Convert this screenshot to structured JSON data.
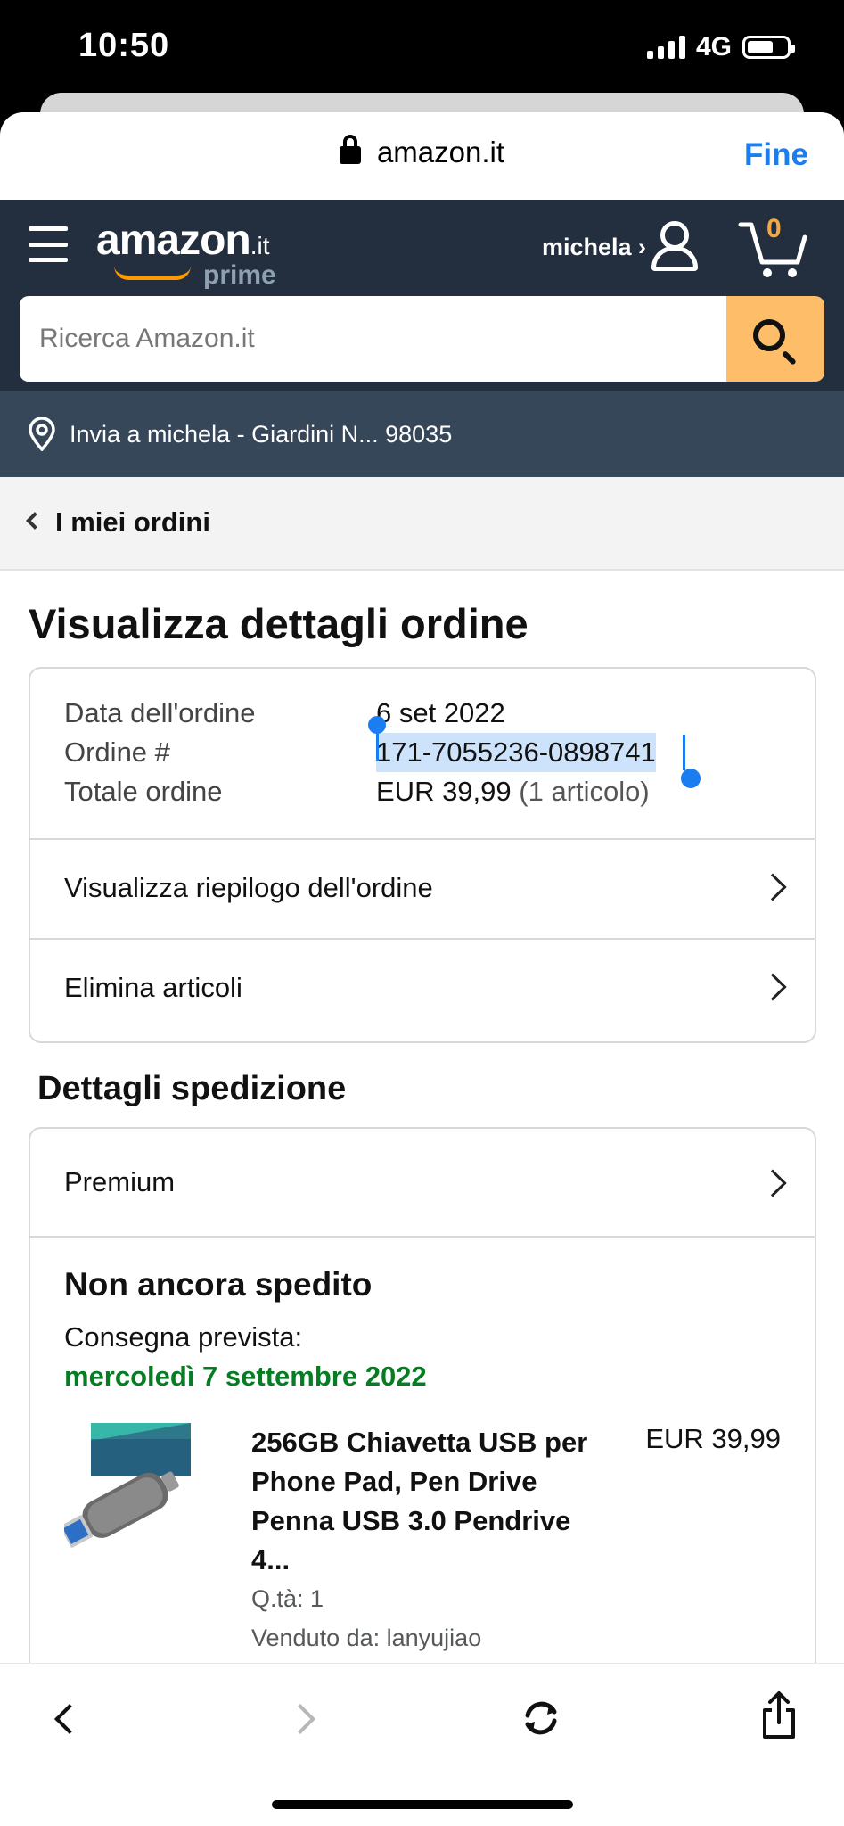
{
  "status_bar": {
    "time": "10:50",
    "network": "4G"
  },
  "browser": {
    "url": "amazon.it",
    "done_label": "Fine"
  },
  "header": {
    "logo_word": "amazon",
    "logo_tld": ".it",
    "logo_prime": "prime",
    "account_label": "michela ›",
    "cart_count": "0",
    "search_placeholder": "Ricerca Amazon.it"
  },
  "delivery": {
    "text": "Invia a michela - Giardini N... 98035"
  },
  "nav": {
    "back_label": "I miei ordini"
  },
  "page": {
    "title": "Visualizza dettagli ordine"
  },
  "order_info": {
    "date_label": "Data dell'ordine",
    "date_value": "6 set 2022",
    "number_label": "Ordine #",
    "number_value": "171-7055236-0898741",
    "total_label": "Totale ordine",
    "total_value": "EUR 39,99",
    "total_items": "(1 articolo)"
  },
  "order_links": {
    "summary": "Visualizza riepilogo dell'ordine",
    "delete_items": "Elimina articoli"
  },
  "shipping": {
    "section_title": "Dettagli spedizione",
    "method": "Premium",
    "status": "Non ancora spedito",
    "eta_label": "Consegna prevista:",
    "eta_date": "mercoledì 7 settembre 2022",
    "product": {
      "title": "256GB Chiavetta USB per Phone Pad, Pen Drive Penna USB 3.0 Pendrive 4...",
      "price": "EUR 39,99",
      "quantity": "Q.tà: 1",
      "seller": "Venduto da: lanyujiao"
    }
  },
  "colors": {
    "header_bg": "#232f3e",
    "delivery_bg": "#37475a",
    "accent_orange": "#febd69",
    "eta_green": "#067d23",
    "link_blue": "#1a7ef0"
  }
}
